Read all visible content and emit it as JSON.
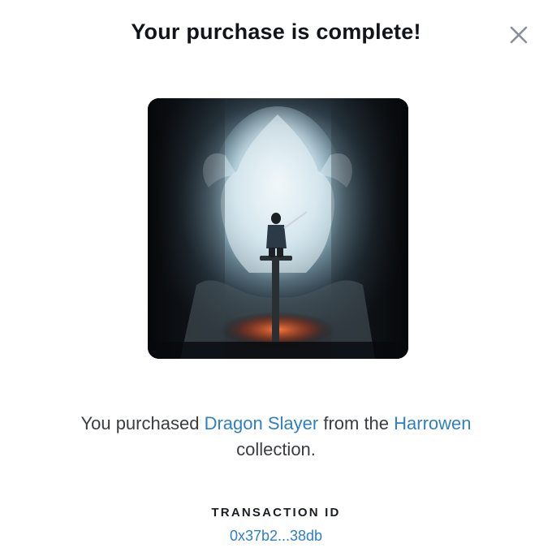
{
  "modal": {
    "title": "Your purchase is complete!",
    "close_icon": "close-icon"
  },
  "artwork": {
    "icon": "nft-artwork-image"
  },
  "message": {
    "prefix": "You purchased",
    "item_name": "Dragon Slayer",
    "middle": "from the",
    "collection_name": "Harrowen",
    "suffix": "collection."
  },
  "transaction": {
    "label": "TRANSACTION ID",
    "id": "0x37b2...38db"
  },
  "colors": {
    "link": "#2f80c4",
    "title": "#111418",
    "body_text": "#3a3d42",
    "close_icon": "#8a9099"
  }
}
